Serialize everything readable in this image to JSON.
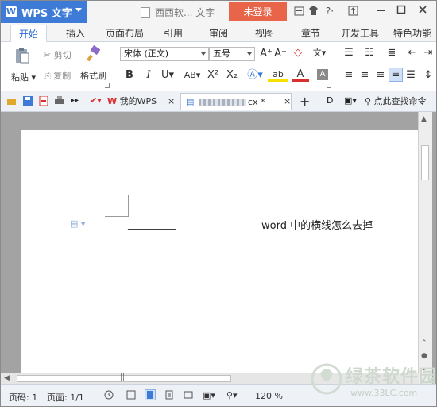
{
  "titlebar": {
    "app_name": "WPS 文字",
    "doc_title": "西西软... 文字",
    "login_label": "未登录",
    "help_label": "?·"
  },
  "tabs": [
    "开始",
    "插入",
    "页面布局",
    "引用",
    "审阅",
    "视图",
    "章节",
    "开发工具",
    "特色功能"
  ],
  "ribbon": {
    "paste": "粘贴",
    "cut": "剪切",
    "copy": "复制",
    "format_painter": "格式刷",
    "font_name": "宋体 (正文)",
    "font_size": "五号",
    "bold": "B",
    "italic": "I",
    "underline": "U",
    "strike": "AB",
    "superscript": "X²",
    "subscript": "X₂",
    "grow": "A⁺",
    "shrink": "A⁻",
    "phonetic": "文",
    "font_color": "A",
    "highlight": "ab"
  },
  "quickbar": {
    "doc_tab_my_wps": "我的WPS",
    "doc_tab_current_suffix": "cx *",
    "search_label": "点此查找命令"
  },
  "document": {
    "line_text": "__________",
    "body_text": "word 中的横线怎么去掉"
  },
  "status": {
    "page": "页码: 1",
    "pages": "页面: 1/1",
    "zoom": "120 %"
  },
  "watermark": {
    "brand": "绿茶软件园",
    "url": "www.33LC.com"
  },
  "colors": {
    "wps_blue": "#3d7bd6",
    "login_orange": "#e8654a",
    "wps_red": "#d9302f",
    "font_color_red": "#d9302f",
    "highlight_yellow": "#f5e000",
    "watermark_green": "#cfd8cf"
  }
}
